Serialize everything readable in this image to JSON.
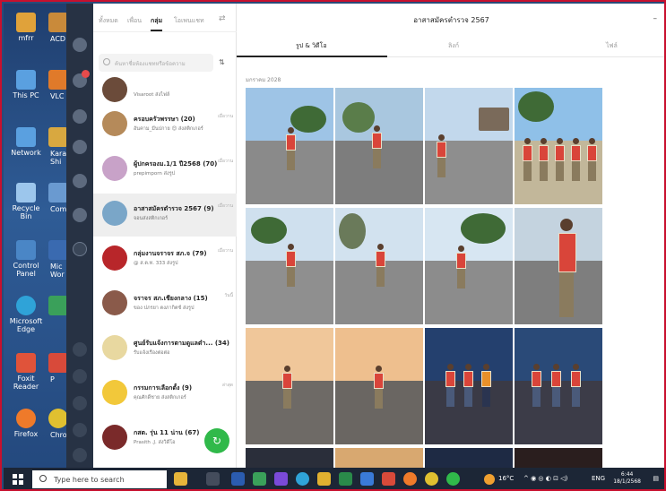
{
  "desktop": {
    "icons": [
      {
        "label": "mfrr",
        "color": "#e0a23a"
      },
      {
        "label": "This PC",
        "color": "#5aa0e0"
      },
      {
        "label": "Network",
        "color": "#5aa0e0"
      },
      {
        "label": "Recycle Bin",
        "color": "#9cc6ec"
      },
      {
        "label": "Control Panel",
        "color": "#4a86c6"
      },
      {
        "label": "Microsoft Edge",
        "color": "#2fa3d8"
      },
      {
        "label": "Foxit Reader",
        "color": "#e0533a"
      },
      {
        "label": "Firefox",
        "color": "#ef7a2a"
      }
    ],
    "icons2": [
      "ACD",
      "VLC",
      "Karal Shi",
      "Com",
      "Mic Wor",
      "",
      "P",
      "Chro"
    ]
  },
  "chat_tabs": [
    "ทั้งหมด",
    "เพื่อน",
    "กลุ่ม",
    "โอเพนแชท"
  ],
  "search": {
    "placeholder": "ค้นหาชื่อห้องแชทหรือข้อความ"
  },
  "chats": [
    {
      "name": "",
      "sub": "Visaroot ส่งไฟล์",
      "time": "",
      "avatar": "#6b4b3a"
    },
    {
      "name": "ครอบครัวพรรษา (20)",
      "sub": "อันคาม_มีนปกาย 😊 ส่งสติกเกอร์",
      "time": "เมื่อวาน",
      "avatar": "#b58a5a"
    },
    {
      "name": "ผู้ปกครองม.1/1 ปี2568 (70)",
      "sub": "prepimporn ส่งรูป",
      "time": "เมื่อวาน",
      "avatar": "#c8a2c8"
    },
    {
      "name": "อาสาสมัครตำรวจ 2567 (9)",
      "sub": "จอนส่งสติกเกอร์",
      "time": "เมื่อวาน",
      "avatar": "#7aa6c8"
    },
    {
      "name": "กลุ่มงานจราจร สภ.จ (79)",
      "sub": "@ ส.ต.ท. 333 ส่งรูป",
      "time": "เมื่อวาน",
      "avatar": "#b8262a"
    },
    {
      "name": "จราจร สภ.เชียงกลาง (15)",
      "sub": "ของ ปภรยา ตงภากิตซ์ ส่งรูป",
      "time": "วันนี้",
      "avatar": "#8a5a4a"
    },
    {
      "name": "ศูนย์รับแจ้งการตามดูแลตำ... (34)",
      "sub": "รับแจ้งเรื่องต่อต่อ",
      "time": "",
      "avatar": "#e8d8a0"
    },
    {
      "name": "กรรมการเลือกตั้ง (9)",
      "sub": "คุณศักดิ์ชาย ส่งสติกเกอร์",
      "time": "ล่าสุด",
      "avatar": "#f2c83a"
    },
    {
      "name": "กสต. รุ่น 11 น่าน (67)",
      "sub": "Prasith .J. ส่งวิดีโอ",
      "time": "",
      "avatar": "#7a2a2a"
    }
  ],
  "album": {
    "title": "อาสาสมัครตำรวจ 2567",
    "tabs": [
      "รูป & วิดีโอ",
      "ลิงก์",
      "ไฟล์"
    ],
    "month": "มกราคม 2028"
  },
  "taskbar": {
    "search_placeholder": "Type here to search",
    "temp": "16°C",
    "lang": "ENG",
    "time": "6:44",
    "date": "18/1/2568"
  },
  "colors": {
    "line_green": "#30b94a",
    "rail": "#273244",
    "frame": "#c8102e"
  }
}
